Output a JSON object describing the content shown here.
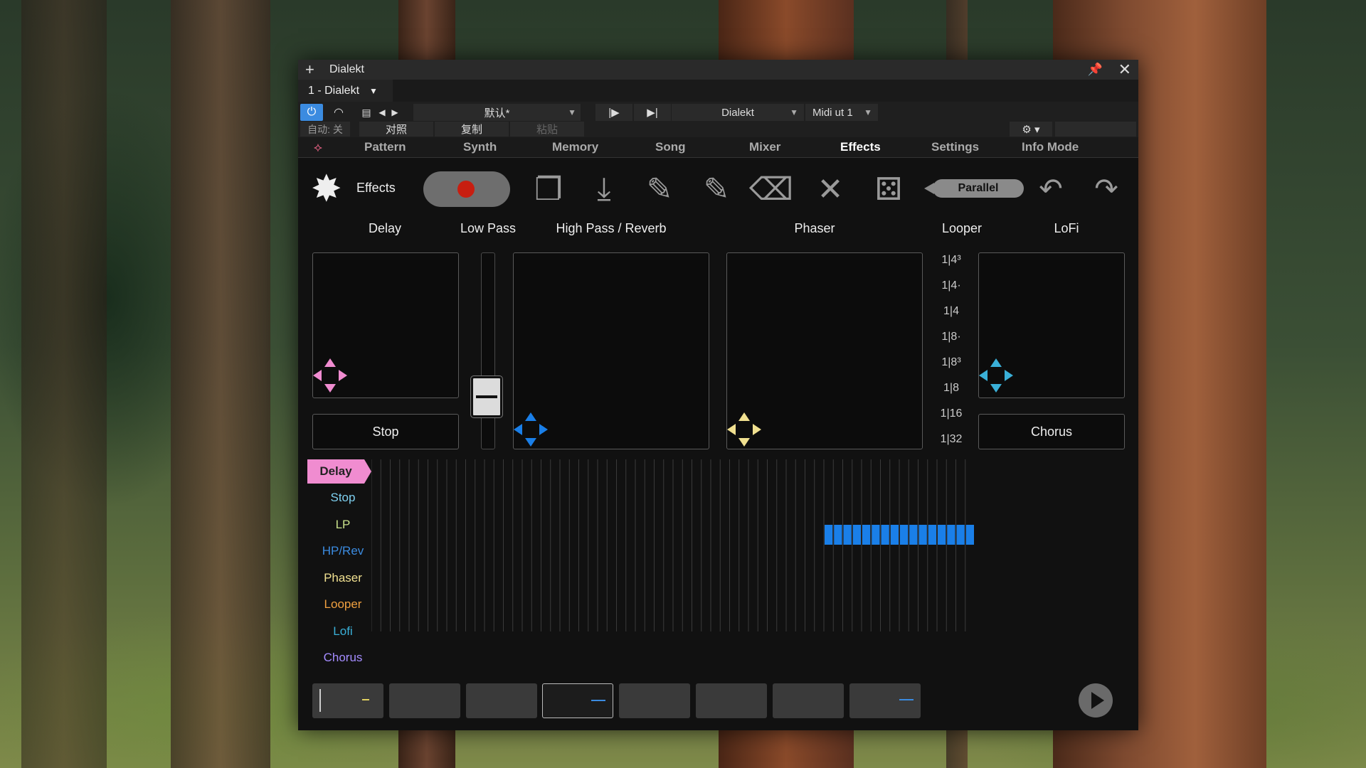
{
  "window": {
    "title": "Dialekt",
    "preset_slot": "1 - Dialekt",
    "pin_icon": "pin-icon",
    "close_icon": "close-icon"
  },
  "toolbar": {
    "preset_name": "默认*",
    "compare_a": "|▶",
    "compare_b": "▶|",
    "device": "Dialekt",
    "midi": "Midi ut 1",
    "auto_label": "自动: 关",
    "compare_label": "对照",
    "copy_label": "复制",
    "paste_label": "粘贴"
  },
  "tabs": [
    "Pattern",
    "Synth",
    "Memory",
    "Song",
    "Mixer",
    "Effects",
    "Settings",
    "Info Mode"
  ],
  "active_tab": "Effects",
  "effects": {
    "header": "Effects",
    "mode": "Parallel",
    "labels": {
      "delay": "Delay",
      "lowpass": "Low Pass",
      "hp_reverb": "High Pass / Reverb",
      "phaser": "Phaser",
      "looper": "Looper",
      "lofi": "LoFi"
    },
    "stop_button": "Stop",
    "chorus_button": "Chorus",
    "looper_divisions": [
      "1|4³",
      "1|4·",
      "1|4",
      "1|8·",
      "1|8³",
      "1|8",
      "1|16",
      "1|32"
    ],
    "lowpass_level": 0.2
  },
  "lanes": [
    "Delay",
    "Stop",
    "LP",
    "HP/Rev",
    "Phaser",
    "Looper",
    "Lofi",
    "Chorus"
  ],
  "colors": {
    "delay": "#f08cd0",
    "stop": "#7ed0f0",
    "lp": "#c8e08a",
    "hprev": "#3b8be0",
    "phaser": "#f0e090",
    "looper": "#f0a040",
    "lofi": "#3ab0d8",
    "chorus": "#a48cff",
    "active_step": "#1a7fe8"
  },
  "patterns": {
    "count": 8,
    "selected_index": 3
  }
}
